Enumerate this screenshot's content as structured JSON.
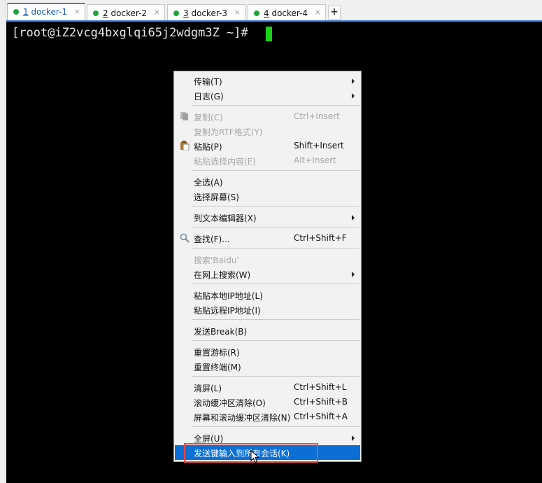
{
  "tabs": [
    {
      "num": "1",
      "name": " docker-1",
      "active": true
    },
    {
      "num": "2",
      "name": " docker-2",
      "active": false
    },
    {
      "num": "3",
      "name": " docker-3",
      "active": false
    },
    {
      "num": "4",
      "name": " docker-4",
      "active": false
    }
  ],
  "tab_close_glyph": "×",
  "new_tab_label": "+",
  "terminal": {
    "prompt": "[root@iZ2vcg4bxglqi65j2wdgm3Z ~]# ",
    "background": "#000000",
    "cursor_color": "#19d119"
  },
  "context_menu": {
    "items": [
      {
        "label": "传输(T)",
        "submenu": true
      },
      {
        "label": "日志(G)",
        "submenu": true
      },
      {
        "label": "复制(C)",
        "shortcut": "Ctrl+Insert",
        "disabled": true,
        "icon": "copy-icon"
      },
      {
        "label": "复制为RTF格式(Y)",
        "disabled": true
      },
      {
        "label": "粘贴(P)",
        "shortcut": "Shift+Insert",
        "icon": "paste-icon"
      },
      {
        "label": "粘贴选择内容(E)",
        "shortcut": "Alt+Insert",
        "disabled": true
      },
      {
        "label": "全选(A)"
      },
      {
        "label": "选择屏幕(S)"
      },
      {
        "label": "到文本编辑器(X)",
        "submenu": true
      },
      {
        "label": "查找(F)...",
        "shortcut": "Ctrl+Shift+F",
        "icon": "magnifier-icon"
      },
      {
        "label": "搜索'Baidu'",
        "disabled": true
      },
      {
        "label": "在网上搜索(W)",
        "submenu": true
      },
      {
        "label": "粘贴本地IP地址(L)"
      },
      {
        "label": "粘贴远程IP地址(I)"
      },
      {
        "label": "发送Break(B)"
      },
      {
        "label": "重置游标(R)"
      },
      {
        "label": "重置终端(M)"
      },
      {
        "label": "清屏(L)",
        "shortcut": "Ctrl+Shift+L"
      },
      {
        "label": "滚动缓冲区清除(O)",
        "shortcut": "Ctrl+Shift+B"
      },
      {
        "label": "屏幕和滚动缓冲区清除(N)",
        "shortcut": "Ctrl+Shift+A"
      },
      {
        "label": "全屏(U)",
        "submenu": true
      },
      {
        "label": "发送键输入到所有会话(K)",
        "highlighted": true
      }
    ]
  },
  "colors": {
    "accent": "#3a7bd5",
    "highlight": "#0b6fd6",
    "callout": "#e34b4b",
    "tab_status": "#1fa339"
  }
}
